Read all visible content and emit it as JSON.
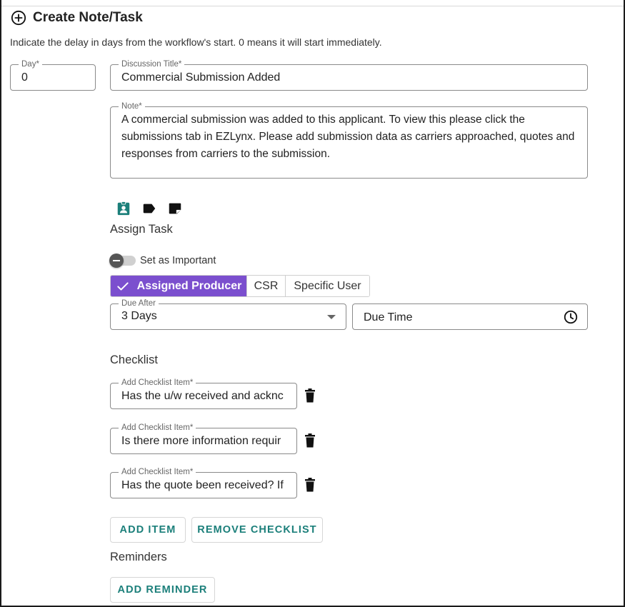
{
  "header": {
    "title": "Create Note/Task",
    "subtitle": "Indicate the delay in days from the workflow's start. 0 means it will start immediately."
  },
  "form": {
    "day": {
      "label": "Day*",
      "value": "0"
    },
    "discussion_title": {
      "label": "Discussion Title*",
      "value": "Commercial Submission Added"
    },
    "note": {
      "label": "Note*",
      "value": "A commercial submission was added to this applicant. To view this please click the submissions tab in EZLynx. Please add submission data as carriers approached, quotes and responses from carriers to the submission."
    }
  },
  "note_type_icons": [
    "assignment-icon",
    "tag-icon",
    "note-icon"
  ],
  "assign_task": {
    "label": "Assign Task",
    "important_toggle": {
      "label": "Set as Important",
      "checked": false
    },
    "assignee_options": [
      "Assigned Producer",
      "CSR",
      "Specific User"
    ],
    "assignee_selected": "Assigned Producer",
    "due_after": {
      "label": "Due After",
      "value": "3 Days"
    },
    "due_time": {
      "placeholder": "Due Time"
    }
  },
  "checklist": {
    "label": "Checklist",
    "items": [
      {
        "label": "Add Checklist Item*",
        "value": "Has the u/w received and acknc"
      },
      {
        "label": "Add Checklist Item*",
        "value": "Is there more information requir"
      },
      {
        "label": "Add Checklist Item*",
        "value": "Has the quote been received? If"
      }
    ],
    "add_item_label": "ADD ITEM",
    "remove_checklist_label": "REMOVE CHECKLIST"
  },
  "reminders": {
    "label": "Reminders",
    "add_reminder_label": "ADD REMINDER"
  },
  "colors": {
    "accent_purple": "#7b4fce",
    "teal": "#1b7f7a",
    "border": "#8a8a8a"
  }
}
